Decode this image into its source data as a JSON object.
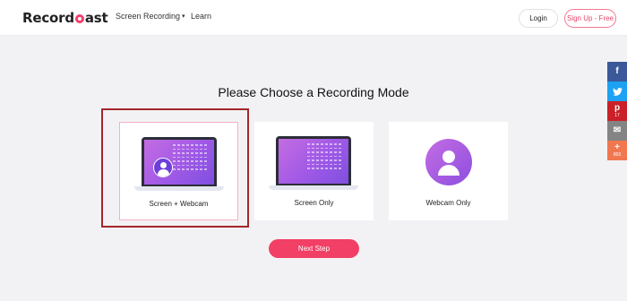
{
  "header": {
    "logo_part1": "Record",
    "logo_part2": "ast",
    "nav": [
      {
        "label": "Screen Recording",
        "has_dropdown": true
      },
      {
        "label": "Learn"
      }
    ],
    "login_label": "Login",
    "signup_label": "Sign Up - Free"
  },
  "main": {
    "title": "Please Choose a Recording Mode",
    "modes": [
      {
        "label": "Screen + Webcam",
        "selected": true
      },
      {
        "label": "Screen Only",
        "selected": false
      },
      {
        "label": "Webcam Only",
        "selected": false
      }
    ],
    "next_label": "Next Step"
  },
  "share": [
    {
      "icon": "facebook-icon",
      "glyph": "f",
      "color": "#3b5998",
      "count": ""
    },
    {
      "icon": "twitter-icon",
      "glyph": "t",
      "color": "#1da1f2",
      "count": ""
    },
    {
      "icon": "pinterest-icon",
      "glyph": "p",
      "color": "#cb2027",
      "count": "17"
    },
    {
      "icon": "email-icon",
      "glyph": "✉",
      "color": "#848484",
      "count": ""
    },
    {
      "icon": "more-share-icon",
      "glyph": "+",
      "color": "#f0774f",
      "count": "803"
    }
  ],
  "colors": {
    "accent": "#f23f65",
    "selection_frame": "#a3262a",
    "avatar_purple": "#8c4fe0"
  }
}
